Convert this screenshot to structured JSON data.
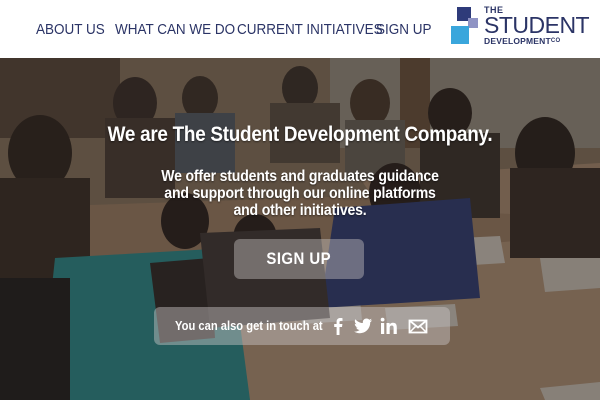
{
  "nav": {
    "items": [
      {
        "label": "ABOUT US"
      },
      {
        "label": "WHAT CAN WE DO"
      },
      {
        "label": "CURRENT INITIATIVES"
      },
      {
        "label": "SIGN UP"
      }
    ]
  },
  "logo": {
    "line1": "THE",
    "line2": "STUDENT",
    "line3": "DEVELOPMENT",
    "suffix": "CO",
    "colors": {
      "dark": "#2e3b7a",
      "mid": "#8f93c4",
      "light": "#3aa6dc"
    }
  },
  "hero": {
    "headline": "We are The Student Development Company.",
    "subline": "We offer students and graduates guidance and support through our online platforms and other initiatives.",
    "signup_label": "SIGN UP",
    "contact_text": "You can also get in touch at",
    "social_icons": [
      "facebook-icon",
      "twitter-icon",
      "linkedin-icon",
      "email-icon"
    ]
  },
  "colors": {
    "nav_text": "#2b3466",
    "hero_text": "#ffffff",
    "button_bg": "rgba(205,200,200,0.42)"
  }
}
